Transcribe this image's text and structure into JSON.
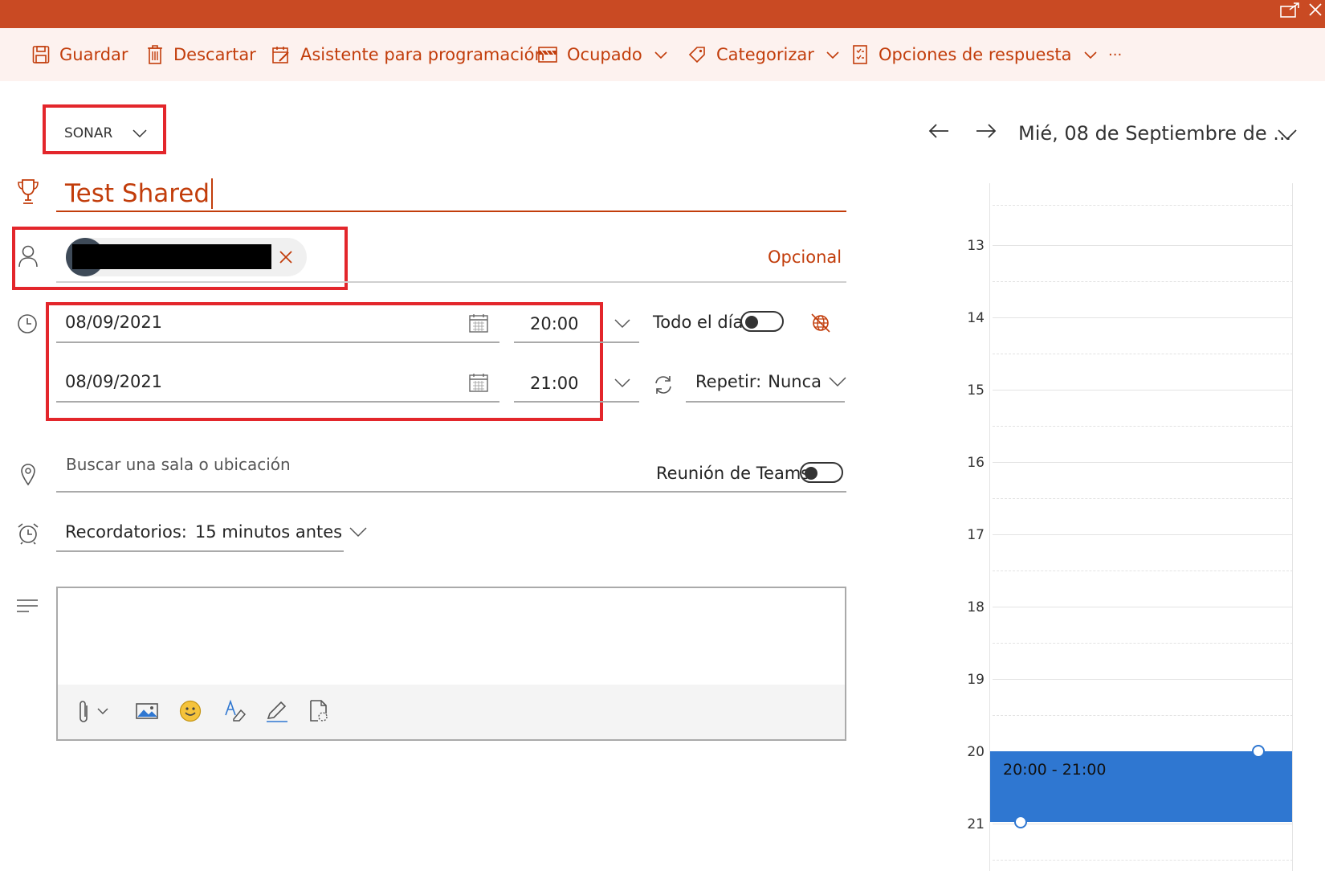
{
  "toolbar": {
    "save_label": "Guardar",
    "discard_label": "Descartar",
    "scheduling_label": "Asistente para programación",
    "busy_label": "Ocupado",
    "categorize_label": "Categorizar",
    "response_label": "Opciones de respuesta",
    "more_label": "···"
  },
  "calendar_select": {
    "value": "SONAR"
  },
  "event": {
    "title": "Test Shared",
    "optional_label": "Opcional",
    "start_date": "08/09/2021",
    "start_time": "20:00",
    "end_date": "08/09/2021",
    "end_time": "21:00",
    "all_day_label": "Todo el día",
    "repeat_label": "Repetir:",
    "repeat_value": "Nunca",
    "location_placeholder": "Buscar una sala o ubicación",
    "teams_label": "Reunión de Teams",
    "reminder_label": "Recordatorios:",
    "reminder_value": "15 minutos antes"
  },
  "day_view": {
    "date_label": "Mié, 08 de Septiembre de ...",
    "hours": [
      "13",
      "14",
      "15",
      "16",
      "17",
      "18",
      "19",
      "20",
      "21"
    ],
    "event_label": "20:00 - 21:00",
    "event_color": "#2f77d1"
  },
  "colors": {
    "accent": "#c23d0b",
    "topbar": "#c94a23",
    "toolbar_bg": "#fdf2ef",
    "highlight": "#e3262b"
  }
}
